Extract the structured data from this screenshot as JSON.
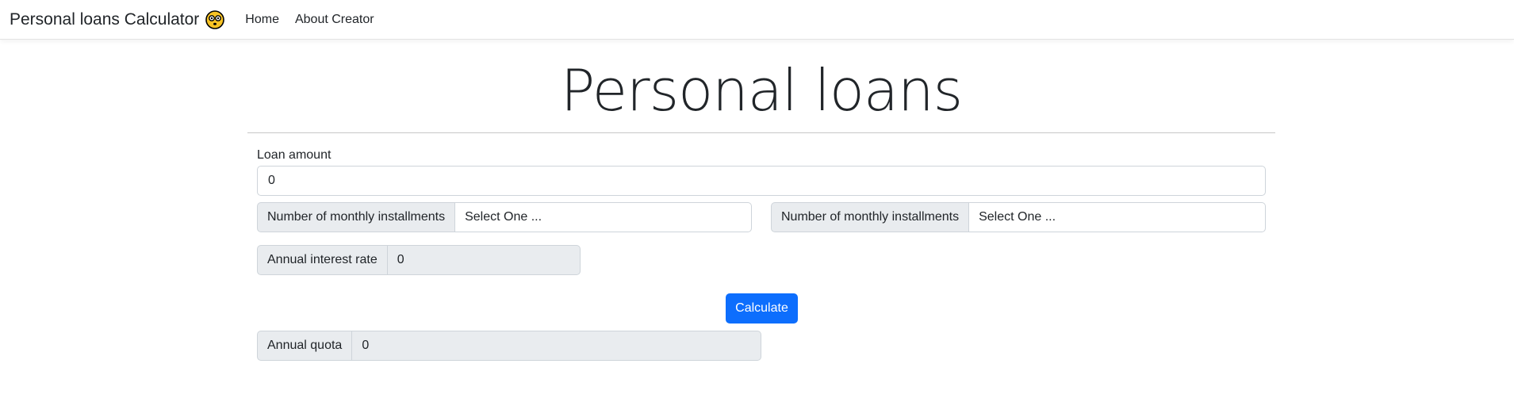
{
  "navbar": {
    "brand": "Personal loans Calculator",
    "brand_icon": "emoji-face-icon",
    "links": [
      "Home",
      "About Creator"
    ]
  },
  "page": {
    "title": "Personal loans"
  },
  "loan_amount": {
    "label": "Loan amount",
    "value": "0"
  },
  "installments_left": {
    "label": "Number of monthly installments",
    "selected": "Select One ..."
  },
  "installments_right": {
    "label": "Number of monthly installments",
    "selected": "Select One ..."
  },
  "interest": {
    "label": "Annual interest rate",
    "value": "0"
  },
  "calculate_button": "Calculate",
  "annual_quota": {
    "label": "Annual quota",
    "value": "0"
  },
  "colors": {
    "primary": "#0d6efd",
    "addon_bg": "#e9ecef",
    "border": "#ced4da"
  }
}
